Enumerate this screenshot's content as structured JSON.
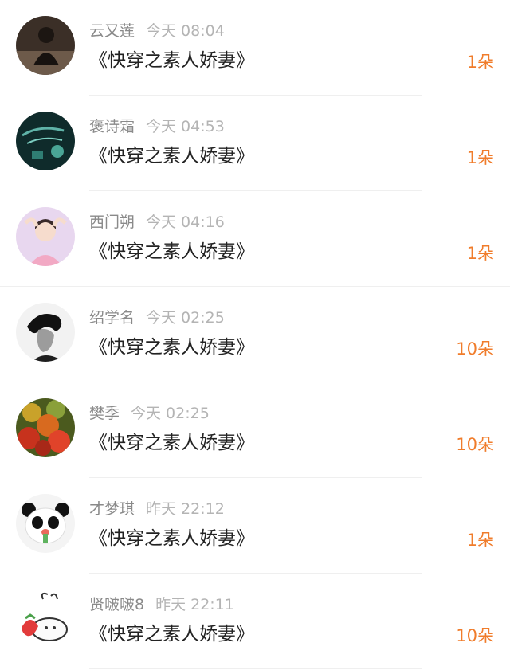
{
  "gift_records": [
    {
      "username": "云又莲",
      "time": "今天 08:04",
      "title": "《快穿之素人娇妻》",
      "gift": "1朵",
      "avatar": "dark-portrait-avatar"
    },
    {
      "username": "褒诗霜",
      "time": "今天 04:53",
      "title": "《快穿之素人娇妻》",
      "gift": "1朵",
      "avatar": "teal-ink-painting-avatar"
    },
    {
      "username": "西门朔",
      "time": "今天 04:16",
      "title": "《快穿之素人娇妻》",
      "gift": "1朵",
      "avatar": "anime-girl-avatar"
    },
    {
      "username": "绍学名",
      "time": "今天 02:25",
      "title": "《快穿之素人娇妻》",
      "gift": "10朵",
      "avatar": "bw-portrait-avatar"
    },
    {
      "username": "樊季",
      "time": "今天 02:25",
      "title": "《快穿之素人娇妻》",
      "gift": "10朵",
      "avatar": "autumn-leaves-avatar"
    },
    {
      "username": "才梦琪",
      "time": "昨天 22:12",
      "title": "《快穿之素人娇妻》",
      "gift": "1朵",
      "avatar": "panda-avatar"
    },
    {
      "username": "贤啵啵8",
      "time": "昨天 22:11",
      "title": "《快穿之素人娇妻》",
      "gift": "10朵",
      "avatar": "strawberry-doodle-avatar"
    }
  ],
  "colors": {
    "gift_accent": "#f07c2b",
    "username": "#8a8a8a",
    "time": "#b4b4b4",
    "title": "#222222"
  }
}
